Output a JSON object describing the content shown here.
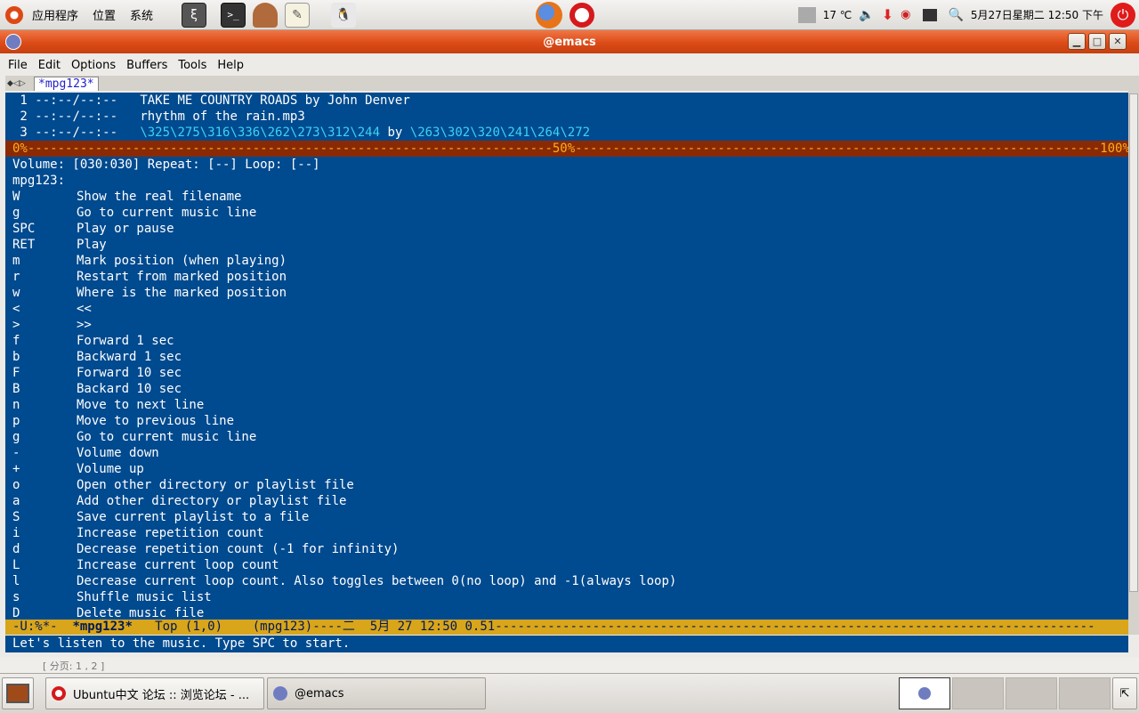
{
  "top_panel": {
    "menus": [
      "应用程序",
      "位置",
      "系统"
    ],
    "tray": {
      "temperature": "17 ℃",
      "datetime": "5月27日星期二 12:50 下午"
    }
  },
  "window": {
    "title": "@emacs"
  },
  "menubar": [
    "File",
    "Edit",
    "Options",
    "Buffers",
    "Tools",
    "Help"
  ],
  "tab": {
    "label": "*mpg123*"
  },
  "playlist": [
    {
      "num": " 1",
      "time": "--:--/--:--",
      "title": "TAKE ME COUNTRY ROADS by John Denver",
      "by": "",
      "artist": ""
    },
    {
      "num": " 2",
      "time": "--:--/--:--",
      "title": "rhythm of the rain.mp3",
      "by": "",
      "artist": ""
    },
    {
      "num": " 3",
      "time": "--:--/--:--",
      "title": "\\325\\275\\316\\336\\262\\273\\312\\244",
      "by": "by",
      "artist": "\\263\\302\\320\\241\\264\\272"
    }
  ],
  "progress": {
    "start": "0%",
    "mid": "50%",
    "end": "100%",
    "value": 0.0
  },
  "status_line": "Volume: [030:030] Repeat: [--] Loop: [--]",
  "help_header": "mpg123:",
  "keys": [
    {
      "key": "W",
      "desc": "Show the real filename"
    },
    {
      "key": "g",
      "desc": "Go to current music line"
    },
    {
      "key": "SPC",
      "desc": "Play or pause"
    },
    {
      "key": "RET",
      "desc": "Play"
    },
    {
      "key": "m",
      "desc": "Mark position (when playing)"
    },
    {
      "key": "r",
      "desc": "Restart from marked position"
    },
    {
      "key": "w",
      "desc": "Where is the marked position"
    },
    {
      "key": "<",
      "desc": "<<"
    },
    {
      "key": ">",
      "desc": ">>"
    },
    {
      "key": "f",
      "desc": "Forward 1 sec"
    },
    {
      "key": "b",
      "desc": "Backward 1 sec"
    },
    {
      "key": "F",
      "desc": "Forward 10 sec"
    },
    {
      "key": "B",
      "desc": "Backard 10 sec"
    },
    {
      "key": "n",
      "desc": "Move to next line"
    },
    {
      "key": "p",
      "desc": "Move to previous line"
    },
    {
      "key": "g",
      "desc": "Go to current music line"
    },
    {
      "key": "-",
      "desc": "Volume down"
    },
    {
      "key": "+",
      "desc": "Volume up"
    },
    {
      "key": "o",
      "desc": "Open other directory or playlist file"
    },
    {
      "key": "a",
      "desc": "Add other directory or playlist file"
    },
    {
      "key": "S",
      "desc": "Save current playlist to a file"
    },
    {
      "key": "i",
      "desc": "Increase repetition count"
    },
    {
      "key": "d",
      "desc": "Decrease repetition count (-1 for infinity)"
    },
    {
      "key": "L",
      "desc": "Increase current loop count"
    },
    {
      "key": "l",
      "desc": "Decrease current loop count. Also toggles between 0(no loop) and -1(always loop)"
    },
    {
      "key": "s",
      "desc": "Shuffle music list"
    },
    {
      "key": "D",
      "desc": "Delete music file"
    }
  ],
  "modeline": {
    "status": "-U:%*-",
    "buffer": "*mpg123*",
    "position": "Top (1,0)",
    "mode": "(mpg123)",
    "time": "----二  5月 27 12:50 0.51"
  },
  "echo_area": "Let's listen to the music. Type SPC to start.",
  "peek": {
    "text": "[ 分页: 1 , 2 ]"
  },
  "taskbar": [
    {
      "label": "Ubuntu中文 论坛 :: 浏览论坛 - ..."
    },
    {
      "label": "@emacs"
    }
  ],
  "colors": {
    "editor_bg": "#004a8f",
    "modeline_bg": "#d8a51b",
    "progress_bg": "#8a2a05",
    "progress_fg": "#ffae1a",
    "titlebar": "#dc4b17",
    "cyan_text": "#3cd3f3"
  },
  "icons": [
    "ubuntu-logo-icon",
    "emacs-launcher-icon",
    "terminal-icon",
    "cleaner-icon",
    "text-editor-icon",
    "penguin-icon",
    "firefox-icon",
    "opera-icon",
    "network-icon",
    "volume-icon",
    "update-icon",
    "magnifier-icon",
    "power-icon"
  ]
}
